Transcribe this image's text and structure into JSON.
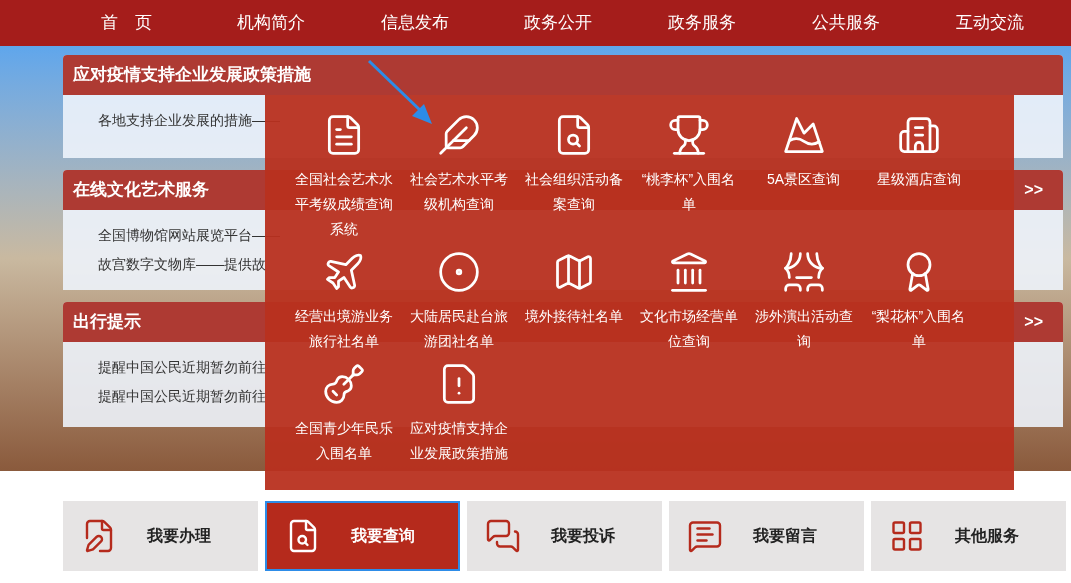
{
  "nav": [
    {
      "label": "首　页"
    },
    {
      "label": "机构简介"
    },
    {
      "label": "信息发布"
    },
    {
      "label": "政务公开"
    },
    {
      "label": "政务服务"
    },
    {
      "label": "公共服务"
    },
    {
      "label": "互动交流"
    }
  ],
  "panels": [
    {
      "title": "应对疫情支持企业发展政策措施",
      "items": [
        "各地支持企业发展的措施——"
      ]
    },
    {
      "title": "在线文化艺术服务",
      "more": ">>",
      "items": [
        "全国博物馆网站展览平台——",
        "故宫数字文物库——提供故"
      ]
    },
    {
      "title": "出行提示",
      "more": ">>",
      "items": [
        "提醒中国公民近期暂勿前往",
        "提醒中国公民近期暂勿前往"
      ]
    }
  ],
  "query_menu": [
    {
      "label": "全国社会艺术水平考级成绩查询系统"
    },
    {
      "label": "社会艺术水平考级机构查询"
    },
    {
      "label": "社会组织活动备案查询"
    },
    {
      "label": "“桃李杯”入围名单"
    },
    {
      "label": "5A景区查询"
    },
    {
      "label": "星级酒店查询"
    },
    {
      "label": "经营出境游业务旅行社名单"
    },
    {
      "label": "大陆居民赴台旅游团社名单"
    },
    {
      "label": "境外接待社名单"
    },
    {
      "label": "文化市场经营单位查询"
    },
    {
      "label": "涉外演出活动查询"
    },
    {
      "label": "“梨花杯”入围名单"
    },
    {
      "label": "全国青少年民乐入围名单"
    },
    {
      "label": "应对疫情支持企业发展政策措施"
    }
  ],
  "services": [
    {
      "label": "我要办理",
      "selected": false
    },
    {
      "label": "我要查询",
      "selected": true
    },
    {
      "label": "我要投诉",
      "selected": false
    },
    {
      "label": "我要留言",
      "selected": false
    },
    {
      "label": "其他服务",
      "selected": false
    }
  ]
}
